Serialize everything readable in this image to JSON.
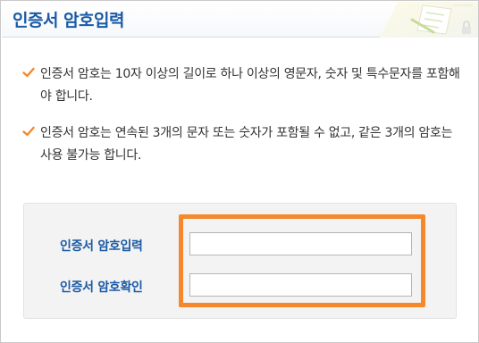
{
  "dialog": {
    "title": "인증서 암호입력"
  },
  "notes": [
    {
      "text": "인증서 암호는 10자 이상의 길이로 하나 이상의 영문자, 숫자 및 특수문자를 포함해야 합니다."
    },
    {
      "text": "인증서 암호는 연속된 3개의 문자 또는 숫자가 포함될 수 없고, 같은 3개의 암호는 사용 불가능 합니다."
    }
  ],
  "form": {
    "password_label": "인증서 암호입력",
    "password_value": "",
    "confirm_label": "인증서 암호확인",
    "confirm_value": ""
  },
  "colors": {
    "title": "#1a5aa5",
    "check": "#f5882b",
    "highlight": "#f5882b"
  }
}
